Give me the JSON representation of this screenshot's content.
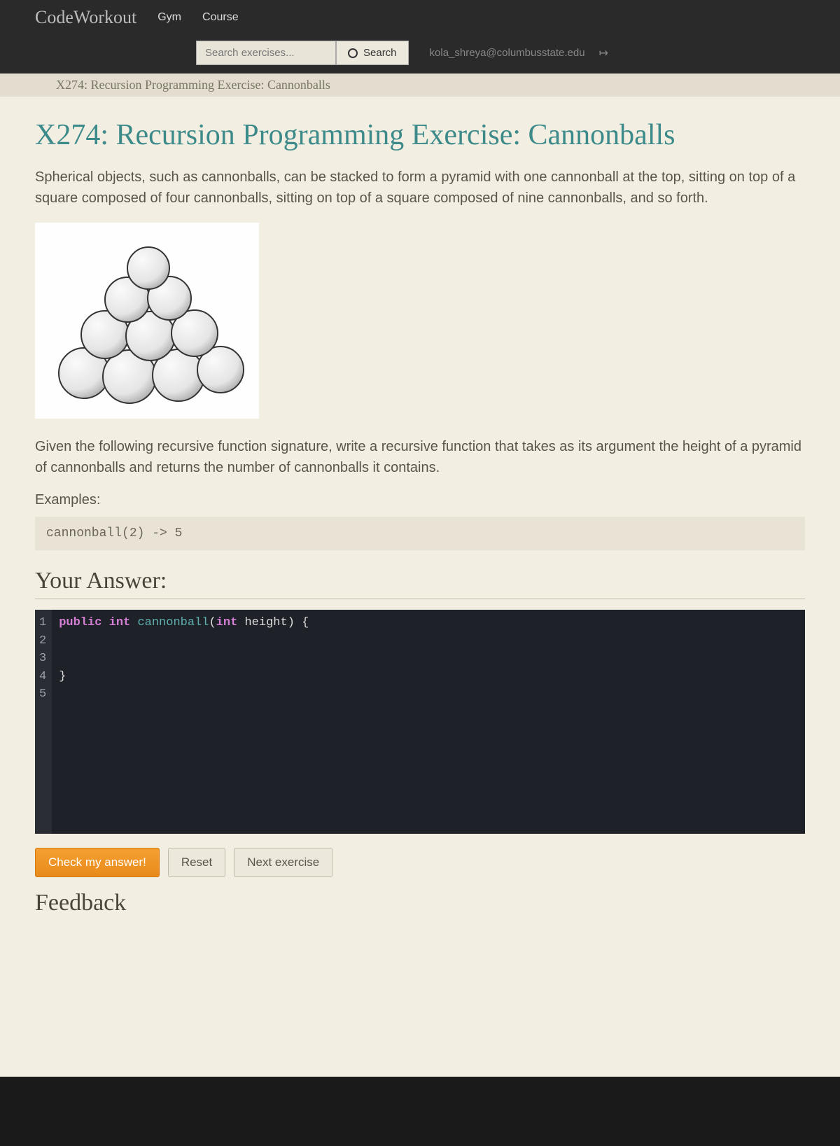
{
  "nav": {
    "brand": "CodeWorkout",
    "links": [
      "Gym",
      "Course"
    ]
  },
  "search": {
    "placeholder": "Search exercises...",
    "button": "Search"
  },
  "user": {
    "email": "kola_shreya@columbusstate.edu"
  },
  "breadcrumb": "X274: Recursion Programming Exercise: Cannonballs",
  "title": "X274: Recursion Programming Exercise: Cannonballs",
  "description": "Spherical objects, such as cannonballs, can be stacked to form a pyramid with one cannonball at the top, sitting on top of a square composed of four cannonballs, sitting on top of a square composed of nine cannonballs, and so forth.",
  "instruction": "Given the following recursive function signature, write a recursive function that takes as its argument the height of a pyramid of cannonballs and returns the number of cannonballs it contains.",
  "examplesLabel": "Examples:",
  "exampleCode": "cannonball(2) -> 5",
  "answerHeading": "Your Answer:",
  "editor": {
    "lines": [
      "1",
      "2",
      "3",
      "4",
      "5"
    ],
    "code": {
      "kw_public": "public",
      "kw_int": "int",
      "fn": "cannonball",
      "sig_open": "(",
      "param_type": "int",
      "param_name": " height",
      "sig_close": ") {",
      "close_brace": "}"
    }
  },
  "buttons": {
    "check": "Check my answer!",
    "reset": "Reset",
    "next": "Next exercise"
  },
  "feedbackHeading": "Feedback"
}
